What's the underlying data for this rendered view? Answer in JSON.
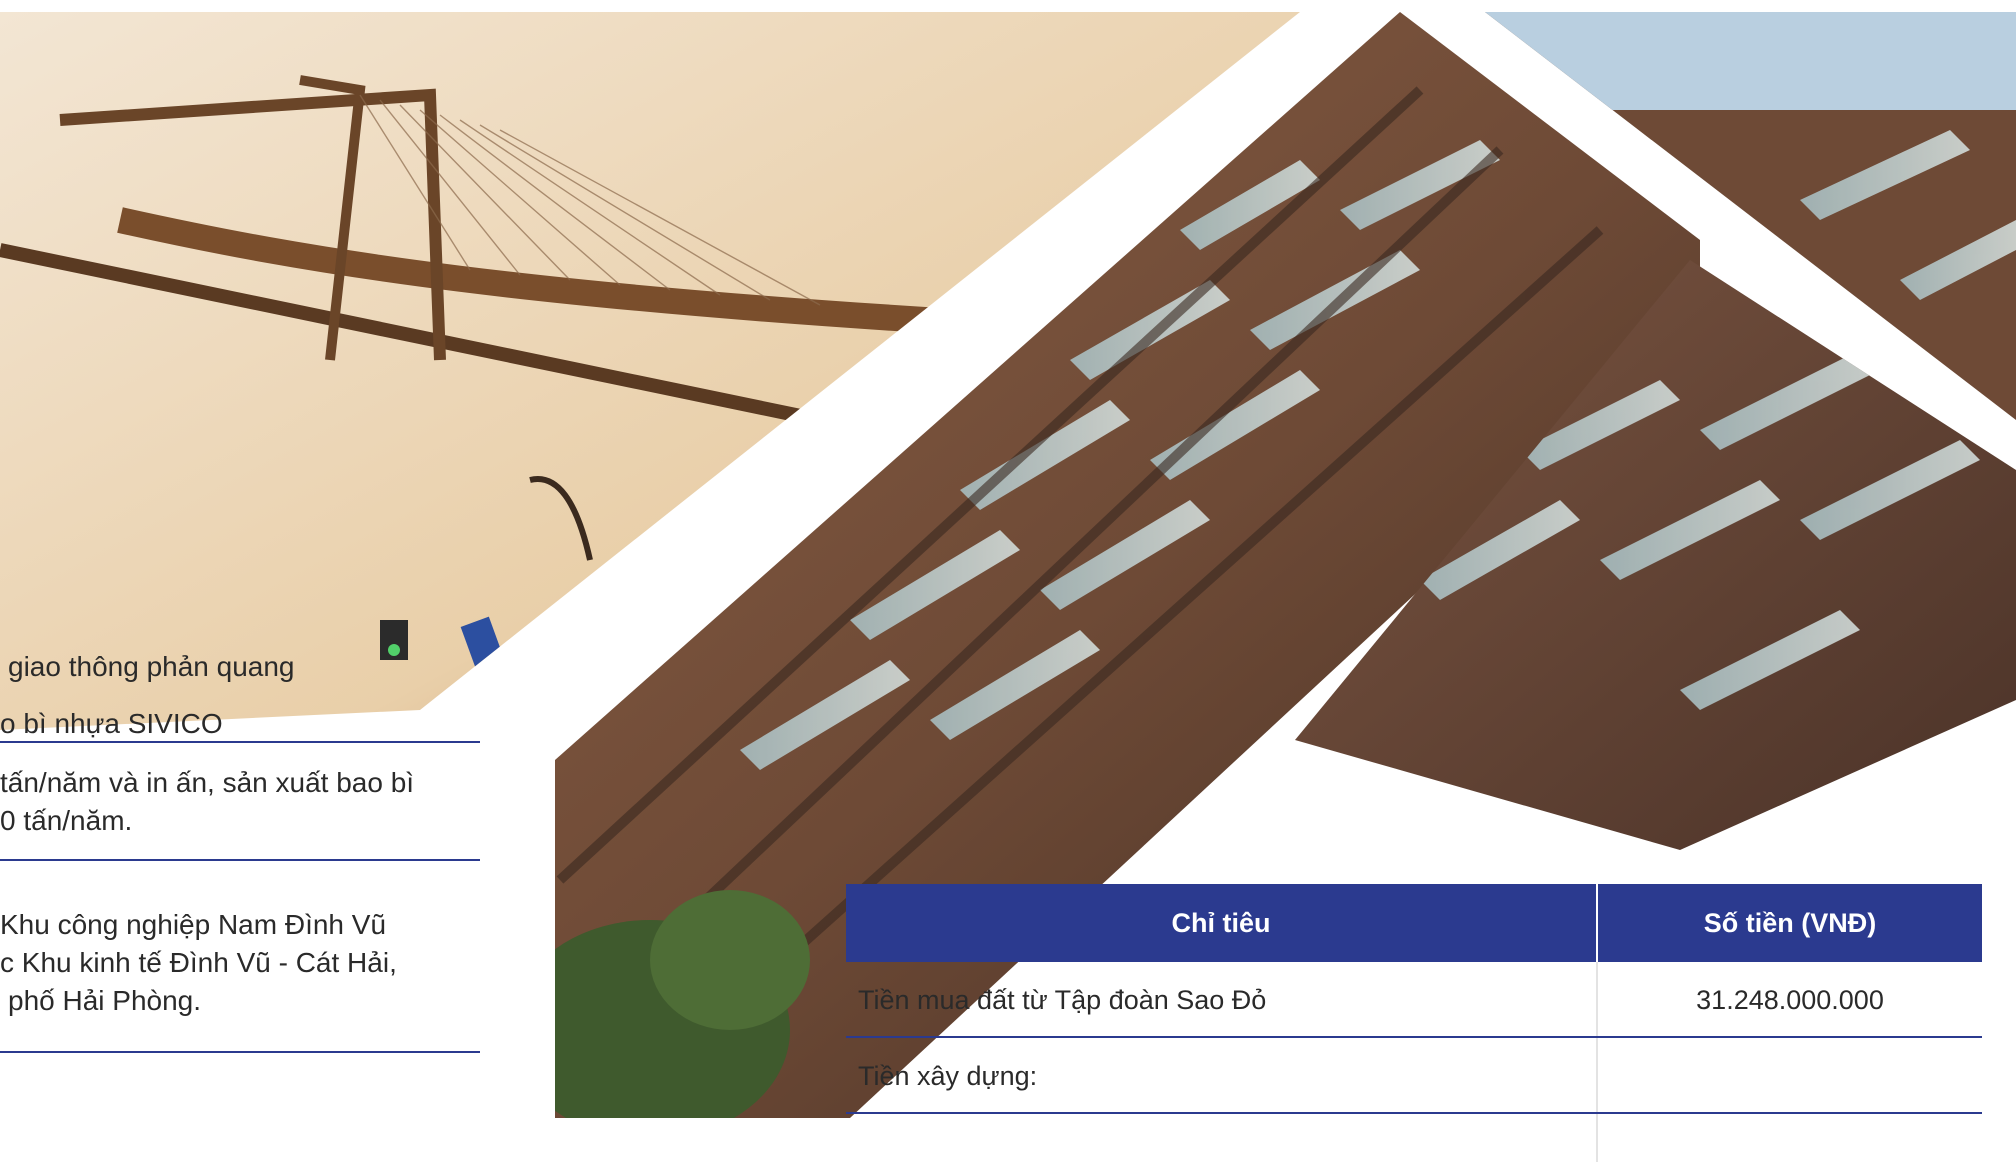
{
  "left_column": {
    "lines": [
      "giao thông phản quang",
      "o bì nhựa SIVICO",
      "tấn/năm và in ấn, sản xuất bao bì",
      "0 tấn/năm.",
      "Khu công nghiệp Nam Đình Vũ",
      "c Khu kinh tế Đình Vũ - Cát Hải,",
      "phố Hải Phòng."
    ]
  },
  "table": {
    "headers": [
      "Chỉ tiêu",
      "Số tiền (VNĐ)"
    ],
    "rows": [
      {
        "label": "Tiền mua đất từ Tập đoàn Sao Đỏ",
        "amount": "31.248.000.000"
      },
      {
        "label": "Tiền xây dựng:",
        "amount": ""
      }
    ]
  },
  "colors": {
    "accent": "#2b3a8f",
    "text": "#2a2a2a"
  }
}
